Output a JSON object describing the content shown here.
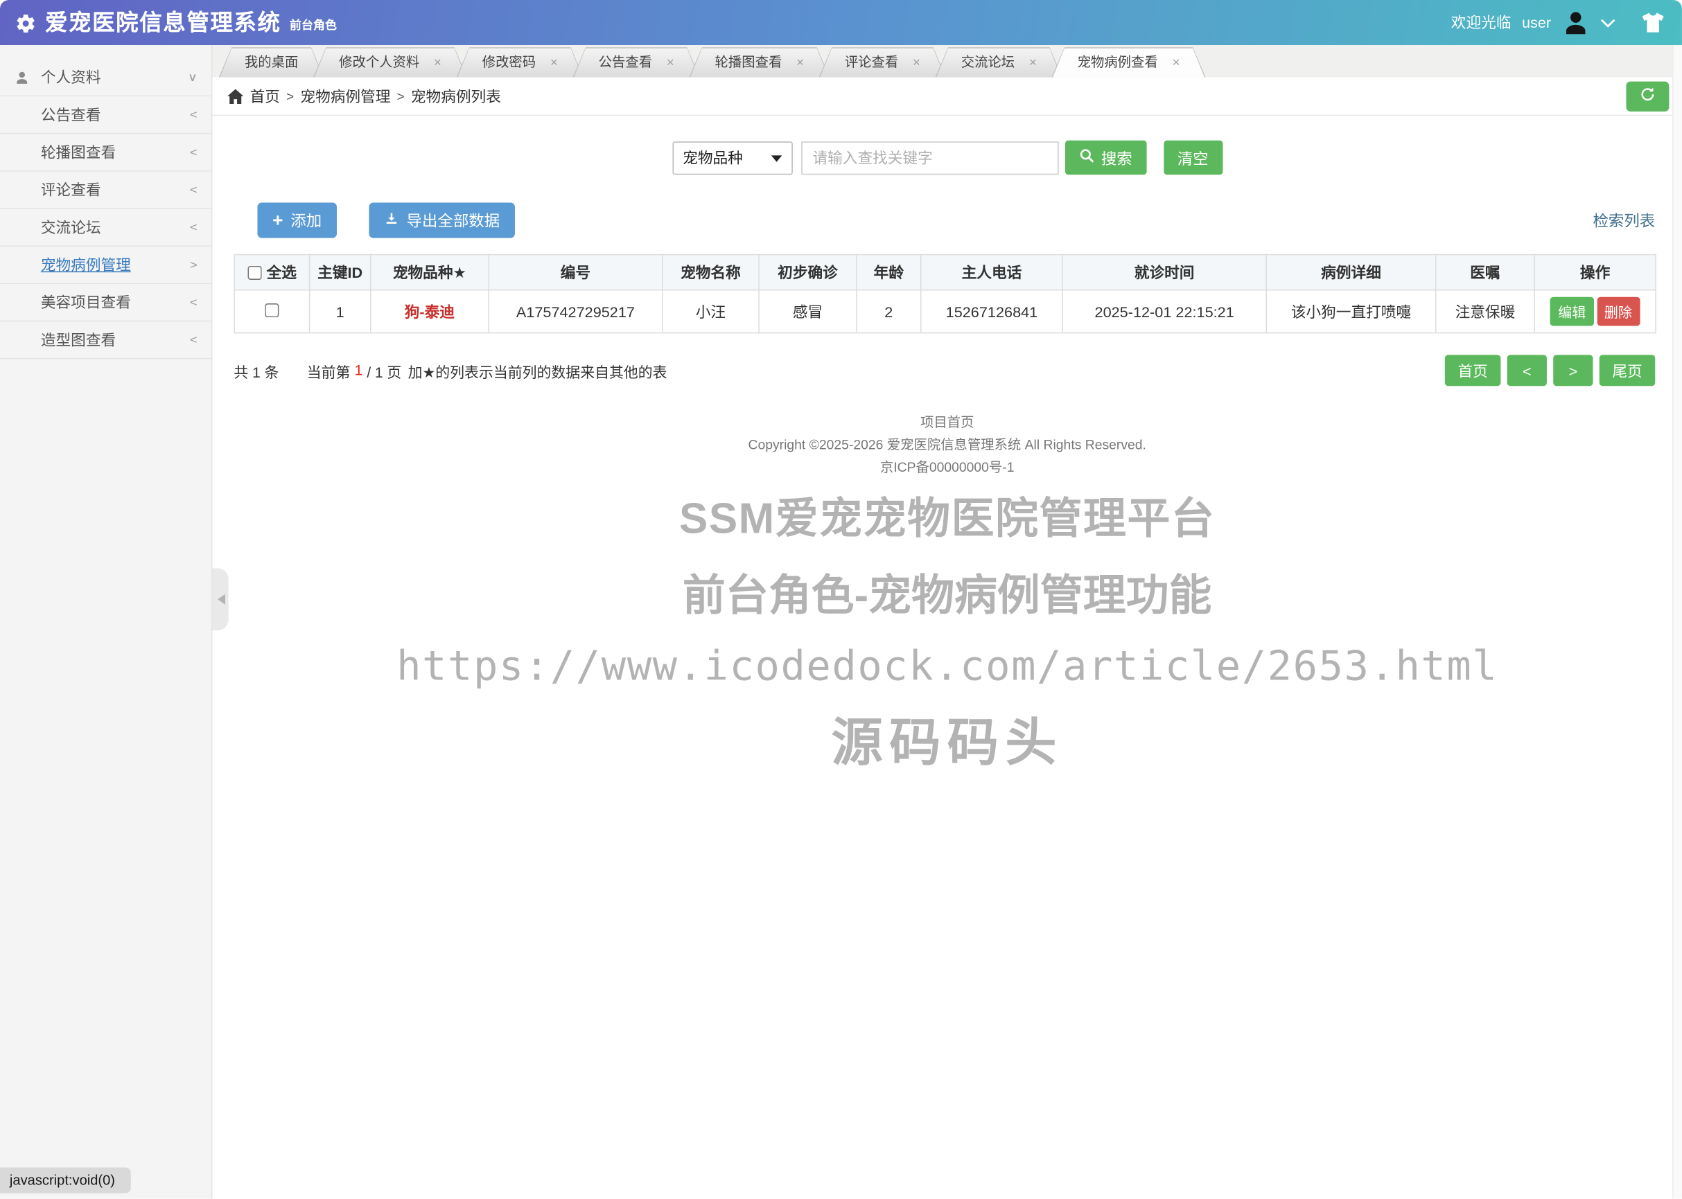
{
  "header": {
    "title": "爱宠医院信息管理系统",
    "subtitle": "前台角色",
    "welcome": "欢迎光临",
    "username": "user"
  },
  "sidebar": {
    "items": [
      {
        "label": "个人资料",
        "arrow": "∨"
      },
      {
        "label": "公告查看",
        "arrow": "<"
      },
      {
        "label": "轮播图查看",
        "arrow": "<"
      },
      {
        "label": "评论查看",
        "arrow": "<"
      },
      {
        "label": "交流论坛",
        "arrow": "<"
      },
      {
        "label": "宠物病例管理",
        "arrow": ">"
      },
      {
        "label": "美容项目查看",
        "arrow": "<"
      },
      {
        "label": "造型图查看",
        "arrow": "<"
      }
    ]
  },
  "tabs": [
    {
      "label": "我的桌面"
    },
    {
      "label": "修改个人资料"
    },
    {
      "label": "修改密码"
    },
    {
      "label": "公告查看"
    },
    {
      "label": "轮播图查看"
    },
    {
      "label": "评论查看"
    },
    {
      "label": "交流论坛"
    },
    {
      "label": "宠物病例查看"
    }
  ],
  "ui": {
    "close_glyph": "×",
    "plus_glyph": "+"
  },
  "breadcrumb": {
    "separator": ">",
    "items": [
      "首页",
      "宠物病例管理",
      "宠物病例列表"
    ]
  },
  "search": {
    "category": "宠物品种",
    "placeholder": "请输入查找关键字",
    "search_label": "搜索",
    "clear_label": "清空"
  },
  "toolbar": {
    "add_label": "添加",
    "export_label": "导出全部数据",
    "list_label": "检索列表"
  },
  "table": {
    "headers": [
      "全选",
      "主键ID",
      "宠物品种★",
      "编号",
      "宠物名称",
      "初步确诊",
      "年龄",
      "主人电话",
      "就诊时间",
      "病例详细",
      "医嘱",
      "操作"
    ],
    "rows": [
      {
        "id": "1",
        "breed": "狗-泰迪",
        "code": "A1757427295217",
        "name": "小汪",
        "diagnosis": "感冒",
        "age": "2",
        "phone": "15267126841",
        "time": "2025-12-01 22:15:21",
        "detail": "该小狗一直打喷嚏",
        "advice": "注意保暖",
        "edit_label": "编辑",
        "delete_label": "删除"
      }
    ]
  },
  "pagination": {
    "total": "共 1 条",
    "current_prefix": "当前第",
    "current_page": "1",
    "current_suffix": "/ 1 页",
    "note": "加★的列表示当前列的数据来自其他的表",
    "first": "首页",
    "prev": "<",
    "next": ">",
    "last": "尾页"
  },
  "footer": {
    "home_link": "项目首页",
    "copyright": "Copyright ©2025-2026 爱宠医院信息管理系统 All Rights Reserved.",
    "icp": "京ICP备00000000号-1"
  },
  "watermark": {
    "line1": "SSM爱宠宠物医院管理平台",
    "line2": "前台角色-宠物病例管理功能",
    "line3": "https://www.icodedock.com/article/2653.html",
    "line4": "源码码头"
  },
  "status": {
    "link_preview": "javascript:void(0)"
  },
  "colors": {
    "header_gradient": [
      "#6164c4",
      "#5a93d0",
      "#4cbdc3"
    ],
    "accent_green": "#5cb85c",
    "accent_blue": "#5b9bd5",
    "danger_red": "#d9534f",
    "breed_red": "#c9302c",
    "active_link_blue": "#3a7bbf"
  }
}
